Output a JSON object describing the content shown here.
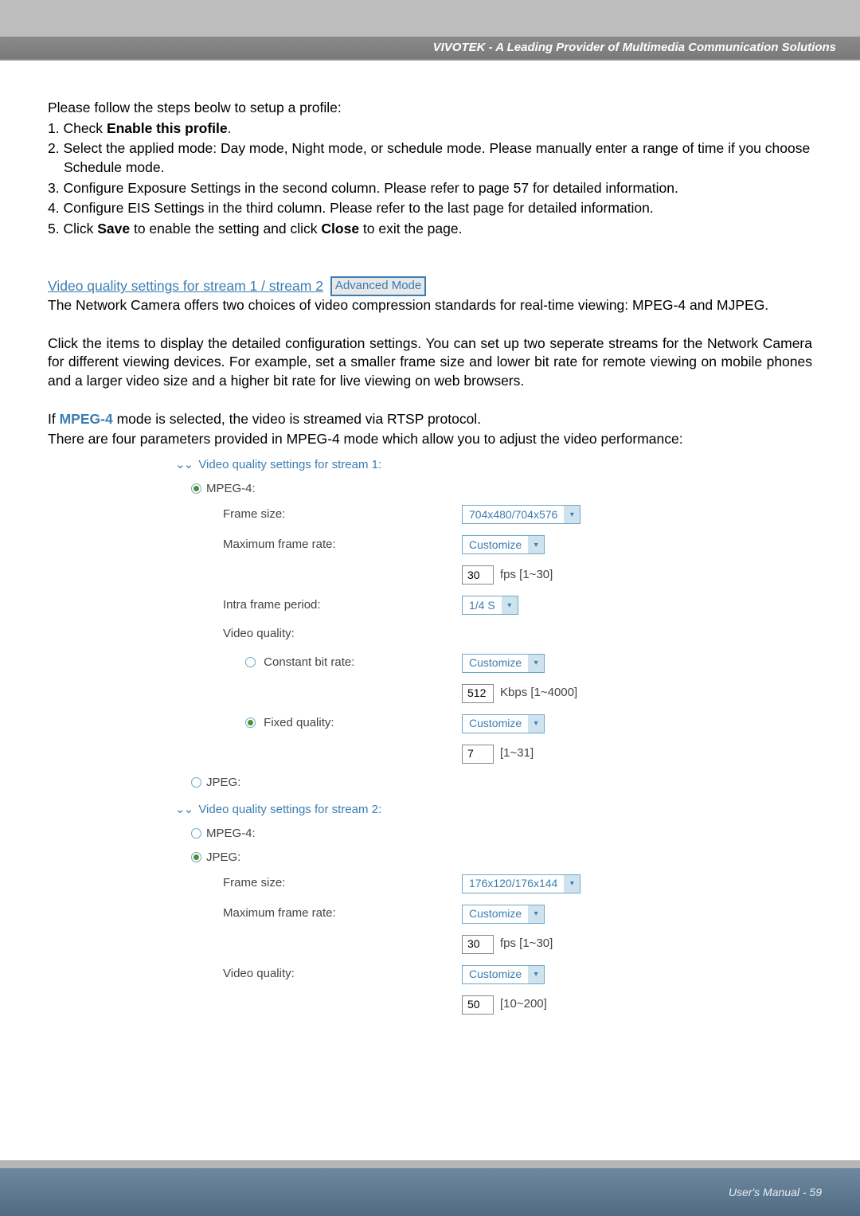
{
  "header": {
    "brand": "VIVOTEK - A Leading Provider of Multimedia Communication Solutions"
  },
  "instructions": {
    "intro": "Please follow the steps beolw to setup a profile:",
    "step1_pre": "1. Check ",
    "step1_bold": "Enable this profile",
    "step1_post": ".",
    "step2": "2. Select the applied mode: Day mode, Night mode, or schedule mode. Please manually enter a range of time if you choose Schedule mode.",
    "step3": "3. Configure Exposure Settings in the second column. Please refer to page 57 for detailed information.",
    "step4": "4. Configure EIS Settings in the third column. Please refer to the last page for detailed information.",
    "step5_pre": "5. Click ",
    "step5_b1": "Save",
    "step5_mid": " to enable the setting and click ",
    "step5_b2": "Close",
    "step5_post": " to exit the page."
  },
  "section": {
    "link_text": "Video quality settings for stream 1 / stream 2",
    "adv_mode": "Advanced Mode",
    "para1": "The Network Camera offers two choices of video compression standards for real-time viewing: MPEG-4 and MJPEG.",
    "para2": "Click the items to display the detailed configuration settings. You can set up two seperate streams for the Network Camera for different viewing devices. For example, set a smaller frame size and lower bit rate for remote viewing on mobile phones and a larger video size and a higher bit rate for live viewing on web browsers.",
    "mpeg_pre": "If ",
    "mpeg_name": "MPEG-4",
    "mpeg_post": " mode is selected, the video is streamed via RTSP protocol.",
    "params_line": "There are four parameters provided in MPEG-4 mode which allow you to adjust the video performance:"
  },
  "stream1": {
    "title": "Video quality settings for stream 1:",
    "mpeg4": "MPEG-4:",
    "jpeg": "JPEG:",
    "labels": {
      "frame_size": "Frame size:",
      "max_frame_rate": "Maximum frame rate:",
      "intra": "Intra frame period:",
      "video_quality": "Video quality:",
      "constant_bit": "Constant bit rate:",
      "fixed_quality": "Fixed quality:"
    },
    "values": {
      "frame_size": "704x480/704x576",
      "max_rate_sel": "Customize",
      "max_rate_num": "30",
      "max_rate_range": "fps [1~30]",
      "intra": "1/4 S",
      "cbr_sel": "Customize",
      "cbr_num": "512",
      "cbr_range": "Kbps [1~4000]",
      "fq_sel": "Customize",
      "fq_num": "7",
      "fq_range": "[1~31]"
    }
  },
  "stream2": {
    "title": "Video quality settings for stream 2:",
    "mpeg4": "MPEG-4:",
    "jpeg": "JPEG:",
    "labels": {
      "frame_size": "Frame size:",
      "max_frame_rate": "Maximum frame rate:",
      "video_quality": "Video quality:"
    },
    "values": {
      "frame_size": "176x120/176x144",
      "max_rate_sel": "Customize",
      "max_rate_num": "30",
      "max_rate_range": "fps [1~30]",
      "vq_sel": "Customize",
      "vq_num": "50",
      "vq_range": "[10~200]"
    }
  },
  "footer": {
    "text": "User's Manual - 59"
  }
}
